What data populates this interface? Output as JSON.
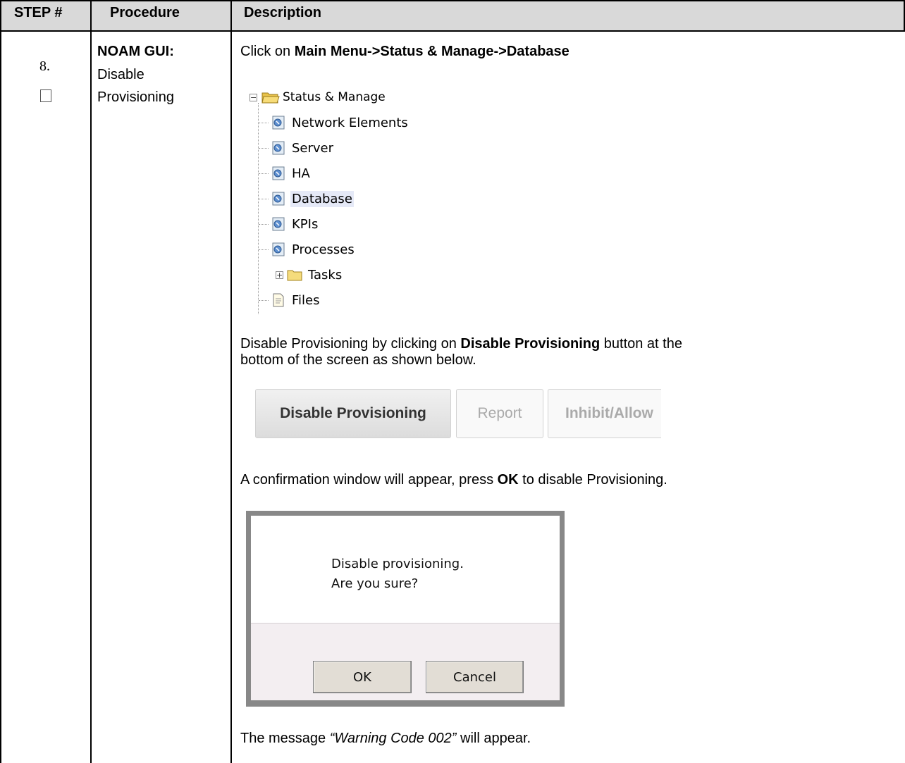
{
  "header": {
    "step": "STEP #",
    "procedure": "Procedure",
    "description": "Description"
  },
  "step": {
    "number": "8.",
    "proc_bold": "NOAM GUI:",
    "proc_line1": "Disable",
    "proc_line2": "Provisioning"
  },
  "desc": {
    "click_prefix": "Click on ",
    "click_path": "Main Menu->Status & Manage->Database",
    "disable_line1_pre": "Disable Provisioning by clicking on ",
    "disable_line1_bold": "Disable Provisioning",
    "disable_line1_post": " button at the",
    "disable_line2": "bottom of the screen as shown below.",
    "confirm_pre": "A confirmation window will appear, press ",
    "confirm_bold": "OK",
    "confirm_post": " to disable Provisioning.",
    "warn_pre": "The message ",
    "warn_italic": "“Warning Code 002”",
    "warn_post": " will appear."
  },
  "tree": {
    "root": "Status & Manage",
    "items": [
      "Network Elements",
      "Server",
      "HA",
      "Database",
      "KPIs",
      "Processes"
    ],
    "tasks": "Tasks",
    "files": "Files",
    "selected": "Database"
  },
  "toolbar": {
    "disable_provisioning": "Disable Provisioning",
    "report": "Report",
    "inhibit_allow": "Inhibit/Allow"
  },
  "dialog": {
    "line1": "Disable provisioning.",
    "line2": "Are you sure?",
    "ok": "OK",
    "cancel": "Cancel"
  }
}
